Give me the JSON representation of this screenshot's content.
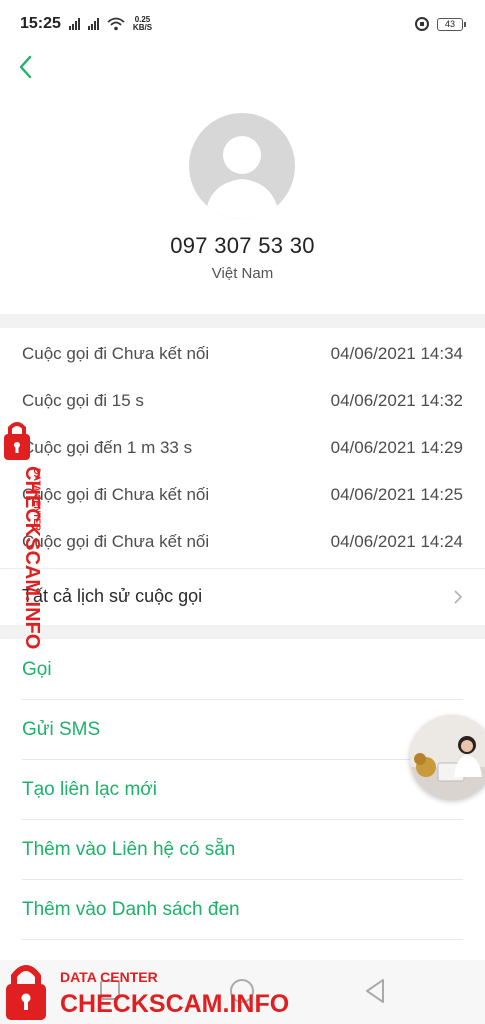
{
  "status_bar": {
    "time": "15:25",
    "speed_value": "0.25",
    "speed_unit": "KB/S",
    "battery": "43"
  },
  "contact": {
    "phone_number": "097 307 53 30",
    "country": "Việt Nam"
  },
  "call_log": [
    {
      "type": "Cuộc gọi đi Chưa kết nối",
      "datetime": "04/06/2021 14:34"
    },
    {
      "type": "Cuộc gọi đi  15 s",
      "datetime": "04/06/2021 14:32"
    },
    {
      "type": "Cuộc gọi đến  1 m 33 s",
      "datetime": "04/06/2021 14:29"
    },
    {
      "type": "Cuộc gọi đi Chưa kết nối",
      "datetime": "04/06/2021 14:25"
    },
    {
      "type": "Cuộc gọi đi Chưa kết nối",
      "datetime": "04/06/2021 14:24"
    }
  ],
  "all_history_label": "Tất cả lịch sử cuộc gọi",
  "actions": [
    {
      "label": "Gọi"
    },
    {
      "label": "Gửi SMS"
    },
    {
      "label": "Tạo liên lạc mới"
    },
    {
      "label": "Thêm vào Liên hệ có sẵn"
    },
    {
      "label": "Thêm vào Danh sách đen"
    }
  ],
  "watermark": {
    "top": "DATA CENTER",
    "bottom": "CHECKSCAM.INFO"
  },
  "colors": {
    "accent_green": "#1eb26b",
    "watermark_red": "#e02020"
  },
  "icons": {
    "back": "chevron-left-icon",
    "more": "chevron-right-icon"
  }
}
